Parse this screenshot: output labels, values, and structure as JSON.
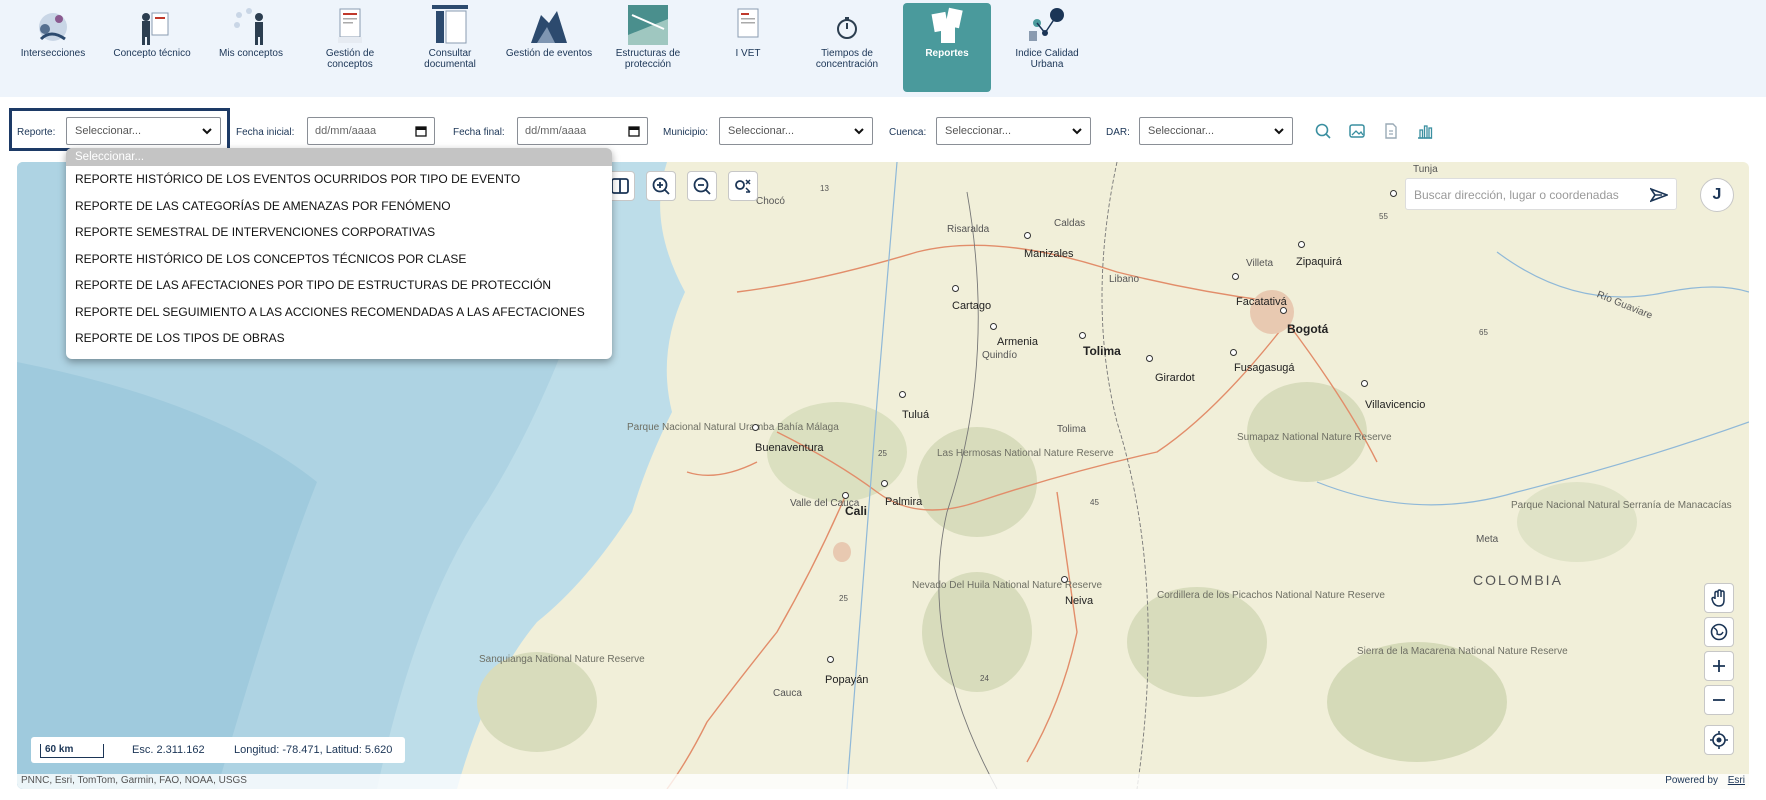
{
  "nav": {
    "items": [
      {
        "label": "Intersecciones",
        "icon": "people-map-icon"
      },
      {
        "label": "Concepto técnico",
        "icon": "presenter-board-icon"
      },
      {
        "label": "Mis conceptos",
        "icon": "person-ideas-icon"
      },
      {
        "label": "Gestión de conceptos",
        "icon": "document-pdf-icon"
      },
      {
        "label": "Consultar documental",
        "icon": "document-columns-icon"
      },
      {
        "label": "Gestión de eventos",
        "icon": "landslide-icon"
      },
      {
        "label": "Estructuras de protección",
        "icon": "retaining-wall-icon"
      },
      {
        "label": "I VET",
        "icon": "document-report-icon"
      },
      {
        "label": "Tiempos de concentración",
        "icon": "stopwatch-icon"
      },
      {
        "label": "Reportes",
        "icon": "reports-papers-icon",
        "active": true
      },
      {
        "label": "Indice Calidad Urbana",
        "icon": "urban-network-icon"
      }
    ]
  },
  "filters": {
    "reporte_label": "Reporte:",
    "reporte_value": "Seleccionar...",
    "fecha_inicial_label": "Fecha inicial:",
    "fecha_inicial_placeholder": "dd/mm/aaaa",
    "fecha_final_label": "Fecha final:",
    "fecha_final_placeholder": "dd/mm/aaaa",
    "municipio_label": "Municipio:",
    "municipio_value": "Seleccionar...",
    "cuenca_label": "Cuenca:",
    "cuenca_value": "Seleccionar...",
    "dar_label": "DAR:",
    "dar_value": "Seleccionar...",
    "tools": [
      "search-icon",
      "image-icon",
      "document-icon",
      "bar-chart-icon"
    ]
  },
  "dropdown": {
    "options": [
      "Seleccionar...",
      "REPORTE HISTÓRICO DE LOS EVENTOS OCURRIDOS POR TIPO DE EVENTO",
      "REPORTE DE LAS CATEGORÍAS DE AMENAZAS POR FENÓMENO",
      "REPORTE SEMESTRAL DE INTERVENCIONES CORPORATIVAS",
      "REPORTE HISTÓRICO DE LOS CONCEPTOS TÉCNICOS POR CLASE",
      "REPORTE DE LAS AFECTACIONES POR TIPO DE ESTRUCTURAS DE PROTECCIÓN",
      "REPORTE DEL SEGUIMIENTO A LAS ACCIONES RECOMENDADAS A LAS AFECTACIONES",
      "REPORTE DE LOS TIPOS DE OBRAS"
    ]
  },
  "map": {
    "search_placeholder": "Buscar dirección, lugar o coordenadas",
    "user_initial": "J",
    "scale_label": "60 km",
    "scale_text": "Esc. 2.311.162",
    "coords_text": "Longitud: -78.471, Latitud: 5.620",
    "attribution": "PNNC, Esri, TomTom, Garmin, FAO, NOAA, USGS",
    "powered_by": "Powered by",
    "powered_link": "Esri",
    "places": {
      "tunja": "Tunja",
      "choco": "Chocó",
      "caldas": "Caldas",
      "risaralda": "Risaralda",
      "manizales": "Manizales",
      "libano": "Libano",
      "villeta": "Villeta",
      "zipaquira": "Zipaquirá",
      "facatativa": "Facatativá",
      "bogota": "Bogotá",
      "rio_guaviare": "Río Guaviare",
      "cartago": "Cartago",
      "armenia": "Armenia",
      "quindio": "Quindío",
      "tolima_city": "Tolima",
      "girardot": "Girardot",
      "fusagasuga": "Fusagasugá",
      "villavicencio": "Villavicencio",
      "tulua": "Tuluá",
      "tolima_dept": "Tolima",
      "buenaventura": "Buenaventura",
      "parque_uramba": "Parque Nacional Natural Uramba Bahía Málaga",
      "hermosas": "Las Hermosas National Nature Reserve",
      "sumapaz": "Sumapaz National Nature Reserve",
      "valle": "Valle del Cauca",
      "palmira": "Palmira",
      "cali": "Cali",
      "macarena_serrania": "Parque Nacional Natural Serranía de Manacacías",
      "meta": "Meta",
      "colombia": "COLOMBIA",
      "nevado_huila": "Nevado Del Huila National Nature Reserve",
      "picachos": "Cordillera de los Picachos National Nature Reserve",
      "neiva": "Neiva",
      "sanquianga": "Sanquianga National Nature Reserve",
      "popayan": "Popayán",
      "cauca": "Cauca",
      "macarena": "Sierra de la Macarena National Nature Reserve",
      "r13": "13",
      "r55": "55",
      "r65": "65",
      "r25a": "25",
      "r25b": "25",
      "r45": "45",
      "r24": "24"
    }
  }
}
